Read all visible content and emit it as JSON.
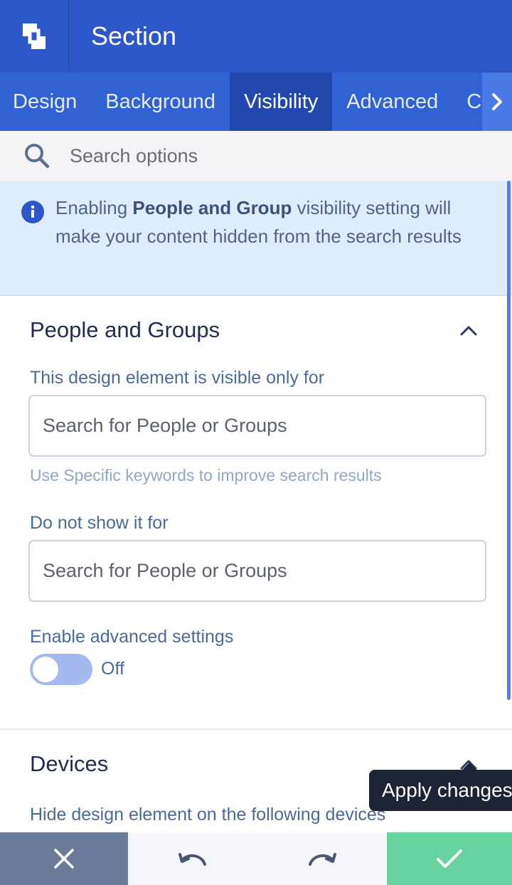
{
  "header": {
    "title": "Section",
    "logo_icon": "builder-logo-icon"
  },
  "tabs": [
    {
      "label": "Design",
      "active": false
    },
    {
      "label": "Background",
      "active": false
    },
    {
      "label": "Visibility",
      "active": true
    },
    {
      "label": "Advanced",
      "active": false
    },
    {
      "label": "C",
      "active": false
    }
  ],
  "search": {
    "placeholder": "Search options"
  },
  "info": {
    "text_before": "Enabling ",
    "text_bold": "People and Group",
    "text_after": " visibility setting will make your content hidden from the search results"
  },
  "people_groups": {
    "title": "People and Groups",
    "visible_for_label": "This design element is visible only for",
    "visible_for_placeholder": "Search for People or Groups",
    "hint": "Use Specific keywords to improve search results",
    "hide_for_label": "Do not show it for",
    "hide_for_placeholder": "Search for People or Groups",
    "advanced_label": "Enable advanced settings",
    "advanced_state": "Off"
  },
  "devices": {
    "title": "Devices",
    "label": "Hide design element on the following devices"
  },
  "tooltip": {
    "text": "Apply changes"
  },
  "colors": {
    "header": "#2d57c8",
    "tabs": "#3062d4",
    "active_tab": "#2248ae",
    "apply": "#66d39e",
    "cancel": "#6d7b9a"
  }
}
